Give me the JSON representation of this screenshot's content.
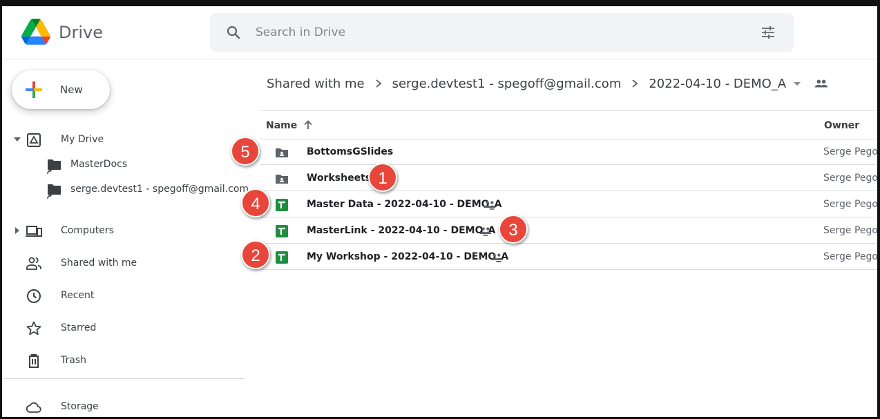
{
  "header": {
    "brand": "Drive",
    "search_placeholder": "Search in Drive"
  },
  "sidebar": {
    "new_label": "New",
    "my_drive": "My Drive",
    "sub_items": [
      "MasterDocs",
      "serge.devtest1 - spegoff@gmail.com"
    ],
    "computers": "Computers",
    "shared_with_me": "Shared with me",
    "recent": "Recent",
    "starred": "Starred",
    "trash": "Trash",
    "storage": "Storage"
  },
  "breadcrumb": [
    "Shared with me",
    "serge.devtest1 - spegoff@gmail.com",
    "2022-04-10 - DEMO_A"
  ],
  "list": {
    "name_header": "Name",
    "owner_header": "Owner",
    "rows": [
      {
        "name": "BottomsGSlides",
        "type": "shared-folder",
        "owner": "Serge Pegof",
        "badge": "5"
      },
      {
        "name": "Worksheets",
        "type": "shared-folder",
        "owner": "Serge Pegof",
        "badge": "1"
      },
      {
        "name": "Master Data - 2022-04-10 - DEMO_A",
        "type": "sheets",
        "owner": "Serge Pegof",
        "badge": "4"
      },
      {
        "name": "MasterLink - 2022-04-10 - DEMO_A",
        "type": "sheets",
        "owner": "Serge Pegof",
        "badge": "3"
      },
      {
        "name": "My Workshop - 2022-04-10 - DEMO_A",
        "type": "sheets",
        "owner": "Serge Pegof",
        "badge": "2"
      }
    ]
  },
  "colors": {
    "badge": "#e8463a",
    "sheets_green": "#1e8e3e",
    "folder_gray": "#5f6368"
  },
  "icons": [
    "drive-logo",
    "search-icon",
    "tune-icon",
    "plus-icon",
    "my-drive-icon",
    "shortcut-folder-icon",
    "computers-icon",
    "shared-icon",
    "clock-icon",
    "star-icon",
    "trash-icon",
    "cloud-icon",
    "people-icon",
    "shared-folder-icon",
    "sheets-icon",
    "arrow-up-icon"
  ]
}
